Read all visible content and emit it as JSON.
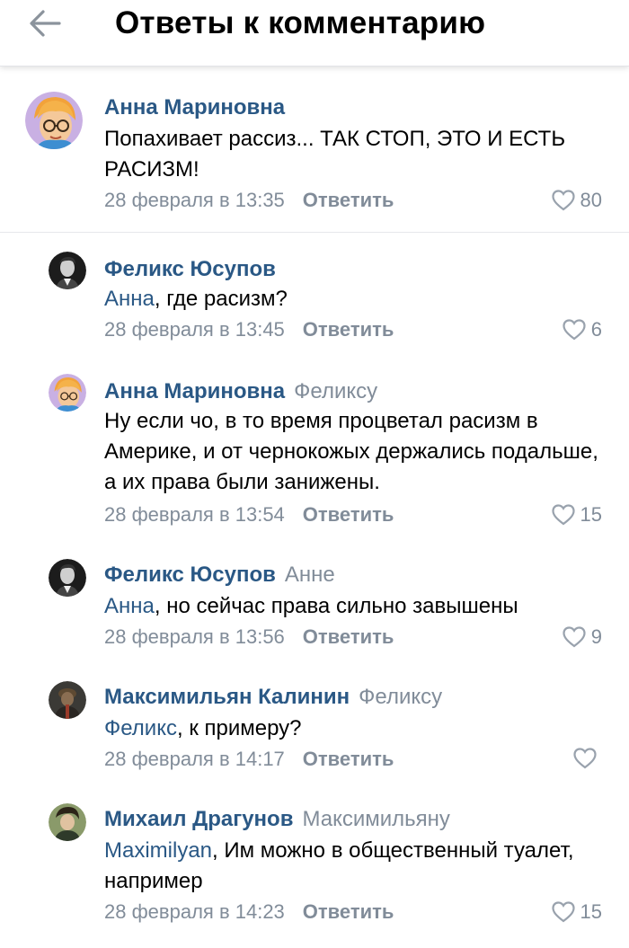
{
  "header": {
    "title": "Ответы к комментарию"
  },
  "reply_label": "Ответить",
  "comments": [
    {
      "author": "Анна Мариновна",
      "reply_to": "",
      "mention": "",
      "text": "Попахивает рассиз... ТАК СТОП, ЭТО И ЕСТЬ РАСИЗМ!",
      "time": "28 февраля в 13:35",
      "likes": "80",
      "avatar": "cartoon-avatar"
    },
    {
      "author": "Феликс Юсупов",
      "reply_to": "",
      "mention": "Анна",
      "text": ", где расизм?",
      "time": "28 февраля в 13:45",
      "likes": "6",
      "avatar": "portrait-avatar"
    },
    {
      "author": "Анна Мариновна",
      "reply_to": "Феликсу",
      "mention": "",
      "text": "Ну если чо, в то время процветал расизм в Америке, и от чернокожых держались подальше, а их права были занижены.",
      "time": "28 февраля в 13:54",
      "likes": "15",
      "avatar": "cartoon-avatar"
    },
    {
      "author": "Феликс Юсупов",
      "reply_to": "Анне",
      "mention": "Анна",
      "text": ", но сейчас права сильно завышены",
      "time": "28 февраля в 13:56",
      "likes": "9",
      "avatar": "portrait-avatar"
    },
    {
      "author": "Максимильян Калинин",
      "reply_to": "Феликсу",
      "mention": "Феликс",
      "text": ", к примеру?",
      "time": "28 февраля в 14:17",
      "likes": "",
      "avatar": "photo-avatar"
    },
    {
      "author": "Михаил Драгунов",
      "reply_to": "Максимильяну",
      "mention": "Maximilyan",
      "text": ", Им можно в общественный туалет, например",
      "time": "28 февраля в 14:23",
      "likes": "15",
      "avatar": "painting-avatar"
    }
  ],
  "colors": {
    "link": "#2a5885",
    "secondary": "#818c99",
    "separator": "#e6e7eb"
  }
}
